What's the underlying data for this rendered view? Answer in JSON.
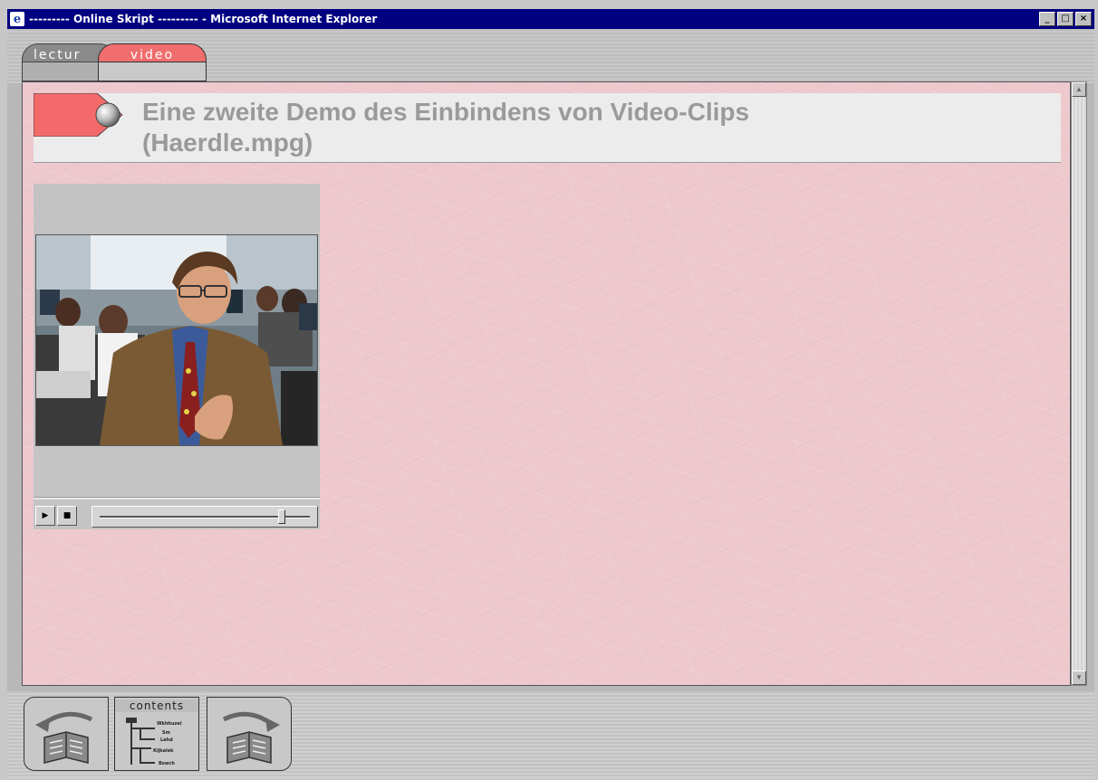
{
  "window": {
    "title": "--------- Online Skript --------- - Microsoft Internet Explorer",
    "app_icon": "internet-explorer-icon",
    "controls": {
      "minimize": "_",
      "maximize": "□",
      "close": "×"
    }
  },
  "tabs": [
    {
      "label": "lecture",
      "visible_label": "lectur",
      "active": false
    },
    {
      "label": "video",
      "active": true
    }
  ],
  "heading": {
    "line1": "Eine zweite Demo des Einbindens von Video-Clips",
    "line2": "(Haerdle.mpg)"
  },
  "player": {
    "play_icon": "play-icon",
    "stop_icon": "stop-icon",
    "position_fraction": 0.88
  },
  "nav": {
    "contents_label": "contents",
    "tree_items": [
      "Wkhhuzel",
      "Sm",
      "Lahd",
      "Kijkalek",
      "Bswch"
    ]
  },
  "colors": {
    "titlebar": "#000080",
    "active_tab": "#f06e6e",
    "page_background": "#edc9ce",
    "heading_text": "#9a9a9a"
  }
}
